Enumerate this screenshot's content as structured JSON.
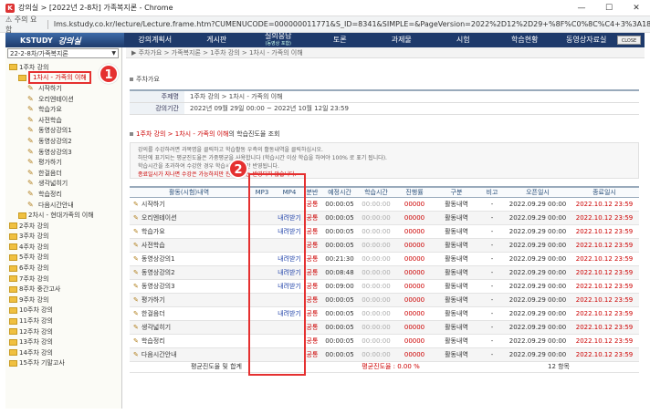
{
  "window": {
    "title": "강의실 > [2022년 2-8차] 가족복지론 - Chrome",
    "minimize": "—",
    "maximize": "☐",
    "close": "✕"
  },
  "urlbar": {
    "warning": "⚠ 주의 요함",
    "url": "lms.kstudy.co.kr/lecture/Lecture.frame.htm?CUMENUCODE=000000011771&S_ID=8341&SIMPLE=&PageVersion=2022%2D12%2D29+%8F%C0%8C%C4+3%3A18%3A03"
  },
  "site": {
    "logo": "KSTUDY",
    "logo_script": "강의실",
    "nav": [
      "강의계획서",
      "게시판",
      "질의응답",
      "토론",
      "과제물",
      "시험",
      "학습현황",
      "동영상자료실"
    ],
    "nav_sub": "(동영상 포함)",
    "close_btn": "CLOSE"
  },
  "sidebar": {
    "course": "22-2-8차/가족복지론",
    "items": [
      {
        "label": "1주차 강의",
        "type": "folder",
        "level": 0
      },
      {
        "label": "1차시 - 가족의 이해",
        "type": "folder",
        "level": 1,
        "active": true
      },
      {
        "label": "시작하기",
        "type": "pencil",
        "level": 2
      },
      {
        "label": "오리엔테이션",
        "type": "pencil",
        "level": 2
      },
      {
        "label": "학습가요",
        "type": "pencil",
        "level": 2
      },
      {
        "label": "사전학습",
        "type": "pencil",
        "level": 2
      },
      {
        "label": "동영상강의1",
        "type": "pencil",
        "level": 2
      },
      {
        "label": "동영상강의2",
        "type": "pencil",
        "level": 2
      },
      {
        "label": "동영상강의3",
        "type": "pencil",
        "level": 2
      },
      {
        "label": "평가하기",
        "type": "pencil",
        "level": 2
      },
      {
        "label": "한걸음더",
        "type": "pencil",
        "level": 2
      },
      {
        "label": "생각넓히기",
        "type": "pencil",
        "level": 2
      },
      {
        "label": "학습정리",
        "type": "pencil",
        "level": 2
      },
      {
        "label": "다음시간안내",
        "type": "pencil",
        "level": 2
      },
      {
        "label": "2차시 - 현대가족의 이해",
        "type": "folder",
        "level": 1
      },
      {
        "label": "2주차 강의",
        "type": "folder",
        "level": 0
      },
      {
        "label": "3주차 강의",
        "type": "folder",
        "level": 0
      },
      {
        "label": "4주차 강의",
        "type": "folder",
        "level": 0
      },
      {
        "label": "5주차 강의",
        "type": "folder",
        "level": 0
      },
      {
        "label": "6주차 강의",
        "type": "folder",
        "level": 0
      },
      {
        "label": "7주차 강의",
        "type": "folder",
        "level": 0
      },
      {
        "label": "8주차 중간고사",
        "type": "folder",
        "level": 0
      },
      {
        "label": "9주차 강의",
        "type": "folder",
        "level": 0
      },
      {
        "label": "10주차 강의",
        "type": "folder",
        "level": 0
      },
      {
        "label": "11주차 강의",
        "type": "folder",
        "level": 0
      },
      {
        "label": "12주차 강의",
        "type": "folder",
        "level": 0
      },
      {
        "label": "13주차 강의",
        "type": "folder",
        "level": 0
      },
      {
        "label": "14주차 강의",
        "type": "folder",
        "level": 0
      },
      {
        "label": "15주차 기말고사",
        "type": "folder",
        "level": 0
      }
    ]
  },
  "badges": {
    "one": "1",
    "two": "2"
  },
  "main": {
    "breadcrumb": "▶ 주차가요 > 가족복지론 > 1주차 강의 > 1차시 - 가족의 이해",
    "section_title": "주차가요",
    "info": {
      "theme_label": "주제명",
      "theme_value": "1주차 강의 > 1차시 - 가족의 이해",
      "period_label": "강의기간",
      "period_value": "2022년 09월 29일 00:00 ~ 2022년 10월 12일 23:59"
    },
    "progress_heading_red": "1주차 강의 > 1차시 - 가족의 이해",
    "progress_heading_rest": "의 학습진도율 조회",
    "notes": [
      "강의를 수강하려면 과목명을 클릭하고 학습활동 우측의 활동내역을 클릭하십시오.",
      "하단에 표기되는 평균진도율은 가중평균을 사용합니다 (학습시간 이상 학습을 하여야 100% 로 표기 됩니다).",
      "학습시간을 초과하여 수강한 경우 학습시간만큼만 반영됩니다.",
      "종료일시가 지나면 수강은 가능하지만 진도율에는 반영되지 않습니다."
    ],
    "table": {
      "headers": [
        "활동(시험)내역",
        "MP3",
        "MP4",
        "분반",
        "예정시간",
        "학습시간",
        "진행률",
        "구분",
        "비고",
        "오픈일시",
        "종료일시"
      ],
      "rows": [
        {
          "name": "시작하기",
          "mp3": "",
          "mp4": "",
          "div": "공통",
          "plan": "00:00:05",
          "study": "00:00:00",
          "prog": "00000",
          "type": "활동내역",
          "note": "-",
          "open": "2022.09.29 00:00",
          "end": "2022.10.12 23:59"
        },
        {
          "name": "오리엔테이션",
          "mp3": "",
          "mp4": "내려받기",
          "div": "공통",
          "plan": "00:00:05",
          "study": "00:00:00",
          "prog": "00000",
          "type": "활동내역",
          "note": "-",
          "open": "2022.09.29 00:00",
          "end": "2022.10.12 23:59"
        },
        {
          "name": "학습가요",
          "mp3": "",
          "mp4": "내려받기",
          "div": "공통",
          "plan": "00:00:05",
          "study": "00:00:00",
          "prog": "00000",
          "type": "활동내역",
          "note": "-",
          "open": "2022.09.29 00:00",
          "end": "2022.10.12 23:59"
        },
        {
          "name": "사전학습",
          "mp3": "",
          "mp4": "",
          "div": "공통",
          "plan": "00:00:05",
          "study": "00:00:00",
          "prog": "00000",
          "type": "활동내역",
          "note": "-",
          "open": "2022.09.29 00:00",
          "end": "2022.10.12 23:59"
        },
        {
          "name": "동영상강의1",
          "mp3": "",
          "mp4": "내려받기",
          "div": "공통",
          "plan": "00:21:30",
          "study": "00:00:00",
          "prog": "00000",
          "type": "활동내역",
          "note": "-",
          "open": "2022.09.29 00:00",
          "end": "2022.10.12 23:59"
        },
        {
          "name": "동영상강의2",
          "mp3": "",
          "mp4": "내려받기",
          "div": "공통",
          "plan": "00:08:48",
          "study": "00:00:00",
          "prog": "00000",
          "type": "활동내역",
          "note": "-",
          "open": "2022.09.29 00:00",
          "end": "2022.10.12 23:59"
        },
        {
          "name": "동영상강의3",
          "mp3": "",
          "mp4": "내려받기",
          "div": "공통",
          "plan": "00:09:00",
          "study": "00:00:00",
          "prog": "00000",
          "type": "활동내역",
          "note": "-",
          "open": "2022.09.29 00:00",
          "end": "2022.10.12 23:59"
        },
        {
          "name": "평가하기",
          "mp3": "",
          "mp4": "",
          "div": "공통",
          "plan": "00:00:05",
          "study": "00:00:00",
          "prog": "00000",
          "type": "활동내역",
          "note": "-",
          "open": "2022.09.29 00:00",
          "end": "2022.10.12 23:59"
        },
        {
          "name": "한걸음더",
          "mp3": "",
          "mp4": "내려받기",
          "div": "공통",
          "plan": "00:00:05",
          "study": "00:00:00",
          "prog": "00000",
          "type": "활동내역",
          "note": "-",
          "open": "2022.09.29 00:00",
          "end": "2022.10.12 23:59"
        },
        {
          "name": "생각넓히기",
          "mp3": "",
          "mp4": "",
          "div": "공통",
          "plan": "00:00:05",
          "study": "00:00:00",
          "prog": "00000",
          "type": "활동내역",
          "note": "-",
          "open": "2022.09.29 00:00",
          "end": "2022.10.12 23:59"
        },
        {
          "name": "학습정리",
          "mp3": "",
          "mp4": "",
          "div": "공통",
          "plan": "00:00:05",
          "study": "00:00:00",
          "prog": "00000",
          "type": "활동내역",
          "note": "-",
          "open": "2022.09.29 00:00",
          "end": "2022.10.12 23:59"
        },
        {
          "name": "다음시간안내",
          "mp3": "",
          "mp4": "",
          "div": "공통",
          "plan": "00:00:05",
          "study": "00:00:00",
          "prog": "00000",
          "type": "활동내역",
          "note": "-",
          "open": "2022.09.29 00:00",
          "end": "2022.10.12 23:59"
        }
      ],
      "footer_avg_label": "평균진도율 및 합계",
      "footer_avg_value": "평균진도율 : 0.00 %",
      "footer_count": "12 항목"
    }
  }
}
